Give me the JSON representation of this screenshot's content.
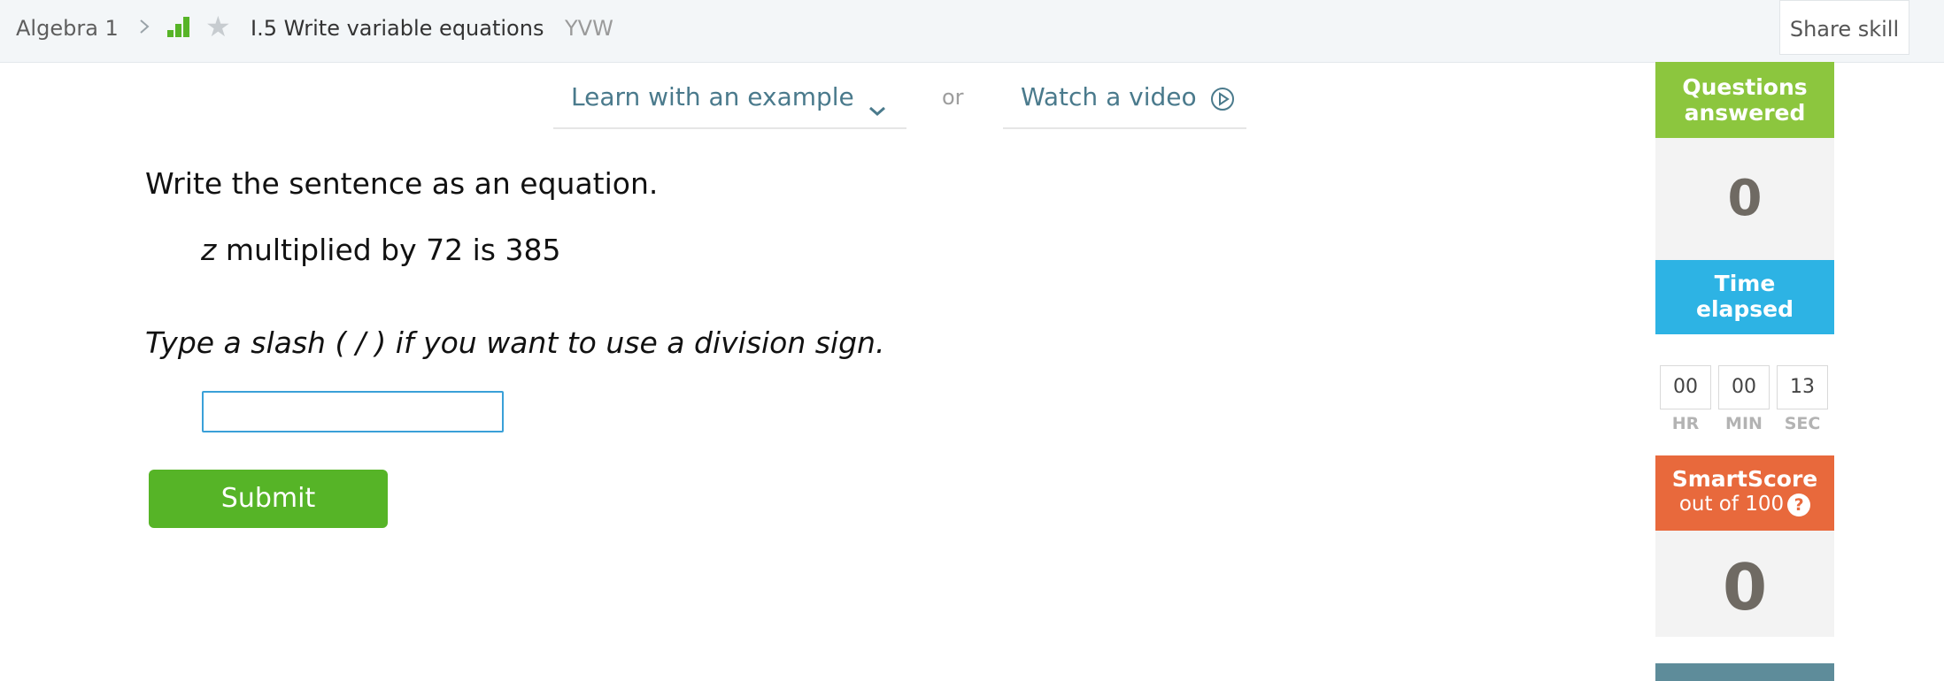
{
  "breadcrumb": {
    "course": "Algebra 1",
    "skill_title": "I.5 Write variable equations",
    "skill_code": "YVW",
    "icons": [
      "chevron-right-icon",
      "signal-bars-icon",
      "star-icon"
    ]
  },
  "header": {
    "share_label": "Share skill"
  },
  "help_links": {
    "example_label": "Learn with an example",
    "or_label": "or",
    "video_label": "Watch a video"
  },
  "question": {
    "instruction": "Write the sentence as an equation.",
    "variable": "z",
    "sentence_rest": " multiplied by 72 is 385",
    "hint": "Type a slash ( / ) if you want to use a division sign.",
    "answer_value": "",
    "submit_label": "Submit"
  },
  "sidebar": {
    "questions_answered": {
      "label_line1": "Questions",
      "label_line2": "answered",
      "value": "0"
    },
    "time_elapsed": {
      "label_line1": "Time",
      "label_line2": "elapsed",
      "hours": "00",
      "minutes": "00",
      "seconds": "13",
      "hours_label": "HR",
      "minutes_label": "MIN",
      "seconds_label": "SEC"
    },
    "smartscore": {
      "label": "SmartScore",
      "sublabel": "out of 100",
      "help_glyph": "?",
      "value": "0"
    }
  },
  "colors": {
    "questions_answered": "#8cc63e",
    "time_elapsed": "#2db3e4",
    "smartscore": "#e8693c",
    "submit": "#56b427",
    "link": "#4a7a8c"
  }
}
